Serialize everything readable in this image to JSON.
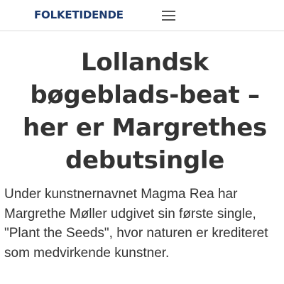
{
  "header": {
    "logo_text": "FOLKETIDENDE",
    "menu_icon": "hamburger-menu-icon",
    "brand_color": "#1c3a6e"
  },
  "article": {
    "title": "Lollandsk bøgeblads-beat – her er Margrethes debutsingle",
    "lead": "Under kunstnernavnet Magma Rea har Margrethe Møller udgivet sin første single, \"Plant the Seeds\", hvor naturen er krediteret som  medvirkende kunstner."
  }
}
